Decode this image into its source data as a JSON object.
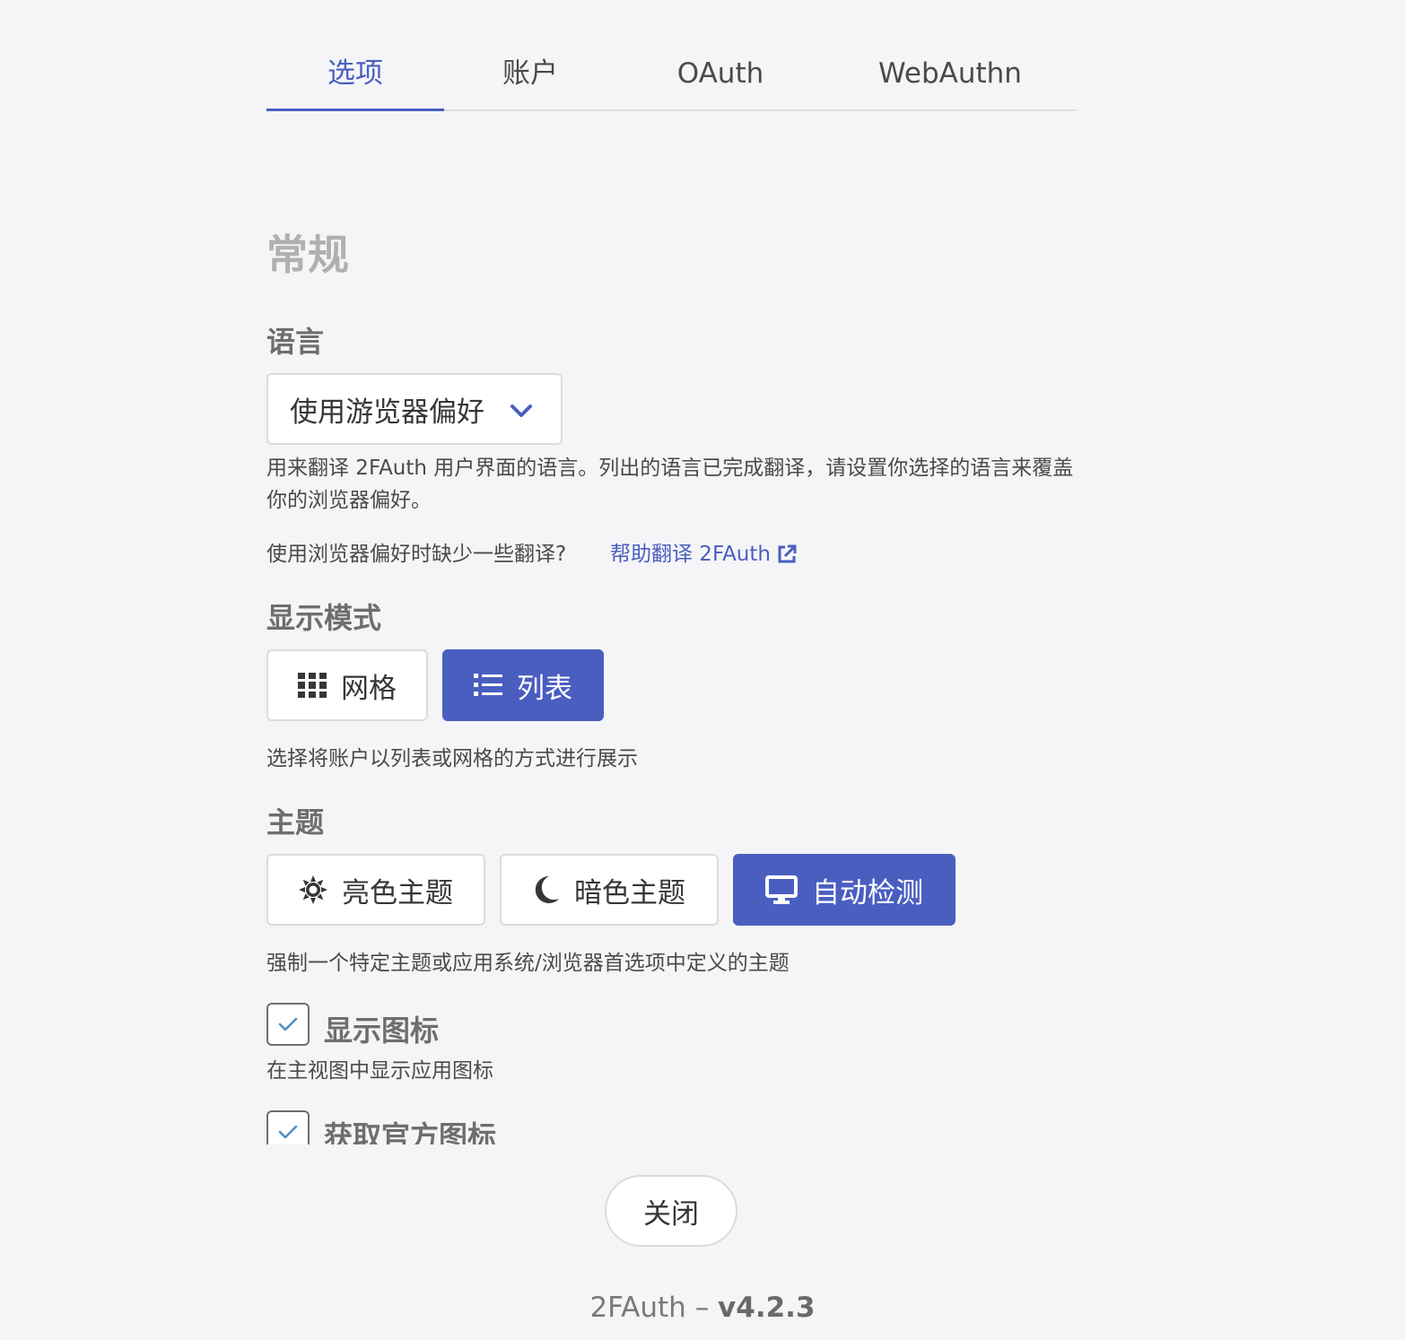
{
  "tabs": [
    {
      "label": "选项",
      "active": true
    },
    {
      "label": "账户",
      "active": false
    },
    {
      "label": "OAuth",
      "active": false
    },
    {
      "label": "WebAuthn",
      "active": false
    }
  ],
  "general": {
    "section_title": "常规",
    "language": {
      "label": "语言",
      "selected": "使用游览器偏好",
      "help": "用来翻译 2FAuth 用户界面的语言。列出的语言已完成翻译，请设置你选择的语言来覆盖你的浏览器偏好。",
      "missing_text": "使用浏览器偏好时缺少一些翻译?",
      "help_link": "帮助翻译 2FAuth"
    },
    "display_mode": {
      "label": "显示模式",
      "options": [
        {
          "label": "网格",
          "icon": "grid-icon",
          "selected": false
        },
        {
          "label": "列表",
          "icon": "list-icon",
          "selected": true
        }
      ],
      "help": "选择将账户以列表或网格的方式进行展示"
    },
    "theme": {
      "label": "主题",
      "options": [
        {
          "label": "亮色主题",
          "icon": "sun-icon",
          "selected": false
        },
        {
          "label": "暗色主题",
          "icon": "moon-icon",
          "selected": false
        },
        {
          "label": "自动检测",
          "icon": "desktop-icon",
          "selected": true
        }
      ],
      "help": "强制一个特定主题或应用系统/浏览器首选项中定义的主题"
    },
    "show_icons": {
      "label": "显示图标",
      "checked": true,
      "help": "在主视图中显示应用图标"
    },
    "fetch_icons": {
      "label": "获取官方图标",
      "checked": true
    }
  },
  "close_label": "关闭",
  "footer": {
    "app": "2FAuth",
    "separator": "–",
    "version": "v4.2.3"
  },
  "colors": {
    "accent": "#4a5ec0",
    "background": "#f5f5f7"
  }
}
